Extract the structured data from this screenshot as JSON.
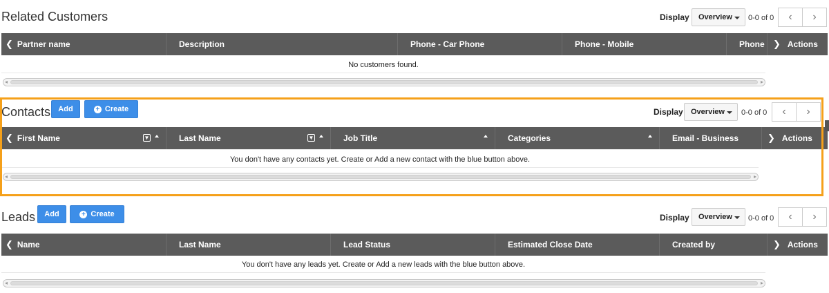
{
  "related": {
    "title": "Related Customers",
    "display_label": "Display",
    "display_value": "Overview",
    "pager_text": "0-0 of 0",
    "columns": [
      "Partner name",
      "Description",
      "Phone - Car Phone",
      "Phone - Mobile",
      "Phone"
    ],
    "actions_label": "Actions",
    "empty_message": "No customers found."
  },
  "contacts": {
    "title": "Contacts",
    "add_label": "Add",
    "create_label": "Create",
    "display_label": "Display",
    "display_value": "Overview",
    "pager_text": "0-0 of 0",
    "columns": [
      "First Name",
      "Last Name",
      "Job Title",
      "Categories",
      "Email - Business"
    ],
    "actions_label": "Actions",
    "empty_message": "You don't have any contacts yet. Create or Add a new contact with the blue button above."
  },
  "leads": {
    "title": "Leads",
    "add_label": "Add",
    "create_label": "Create",
    "display_label": "Display",
    "display_value": "Overview",
    "pager_text": "0-0 of 0",
    "columns": [
      "Name",
      "Last Name",
      "Lead Status",
      "Estimated Close Date",
      "Created by"
    ],
    "actions_label": "Actions",
    "empty_message": "You don't have any leads yet. Create or Add a new leads with the blue button above."
  },
  "colors": {
    "header_bg": "#5b5b5b",
    "button_blue": "#3d8ee8",
    "highlight": "#f5a01a"
  },
  "icons": {
    "prev": "chevron-left-icon",
    "next": "chevron-right-icon",
    "filter": "filter-icon",
    "plus": "plus-circle-icon"
  }
}
